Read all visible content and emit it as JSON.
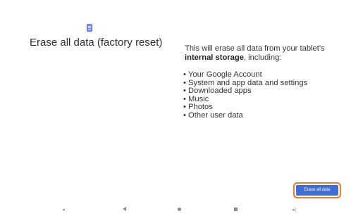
{
  "header": {
    "icon": "document-icon",
    "title": "Erase all data (factory reset)"
  },
  "description": {
    "prefix": "This will erase all data from your tablet's ",
    "bold": "internal storage",
    "suffix": ", including:"
  },
  "items": [
    "Your Google Account",
    "System and app data and settings",
    "Downloaded apps",
    "Music",
    "Photos",
    "Other user data"
  ],
  "erase_button": {
    "label": "Erase all data",
    "highlight_color": "#ef7d2c",
    "color": "#3f6fd6"
  },
  "navigation_bar": {
    "icons": [
      "volume-down-icon",
      "back-icon",
      "home-icon",
      "recents-icon",
      "volume-up-icon"
    ]
  }
}
